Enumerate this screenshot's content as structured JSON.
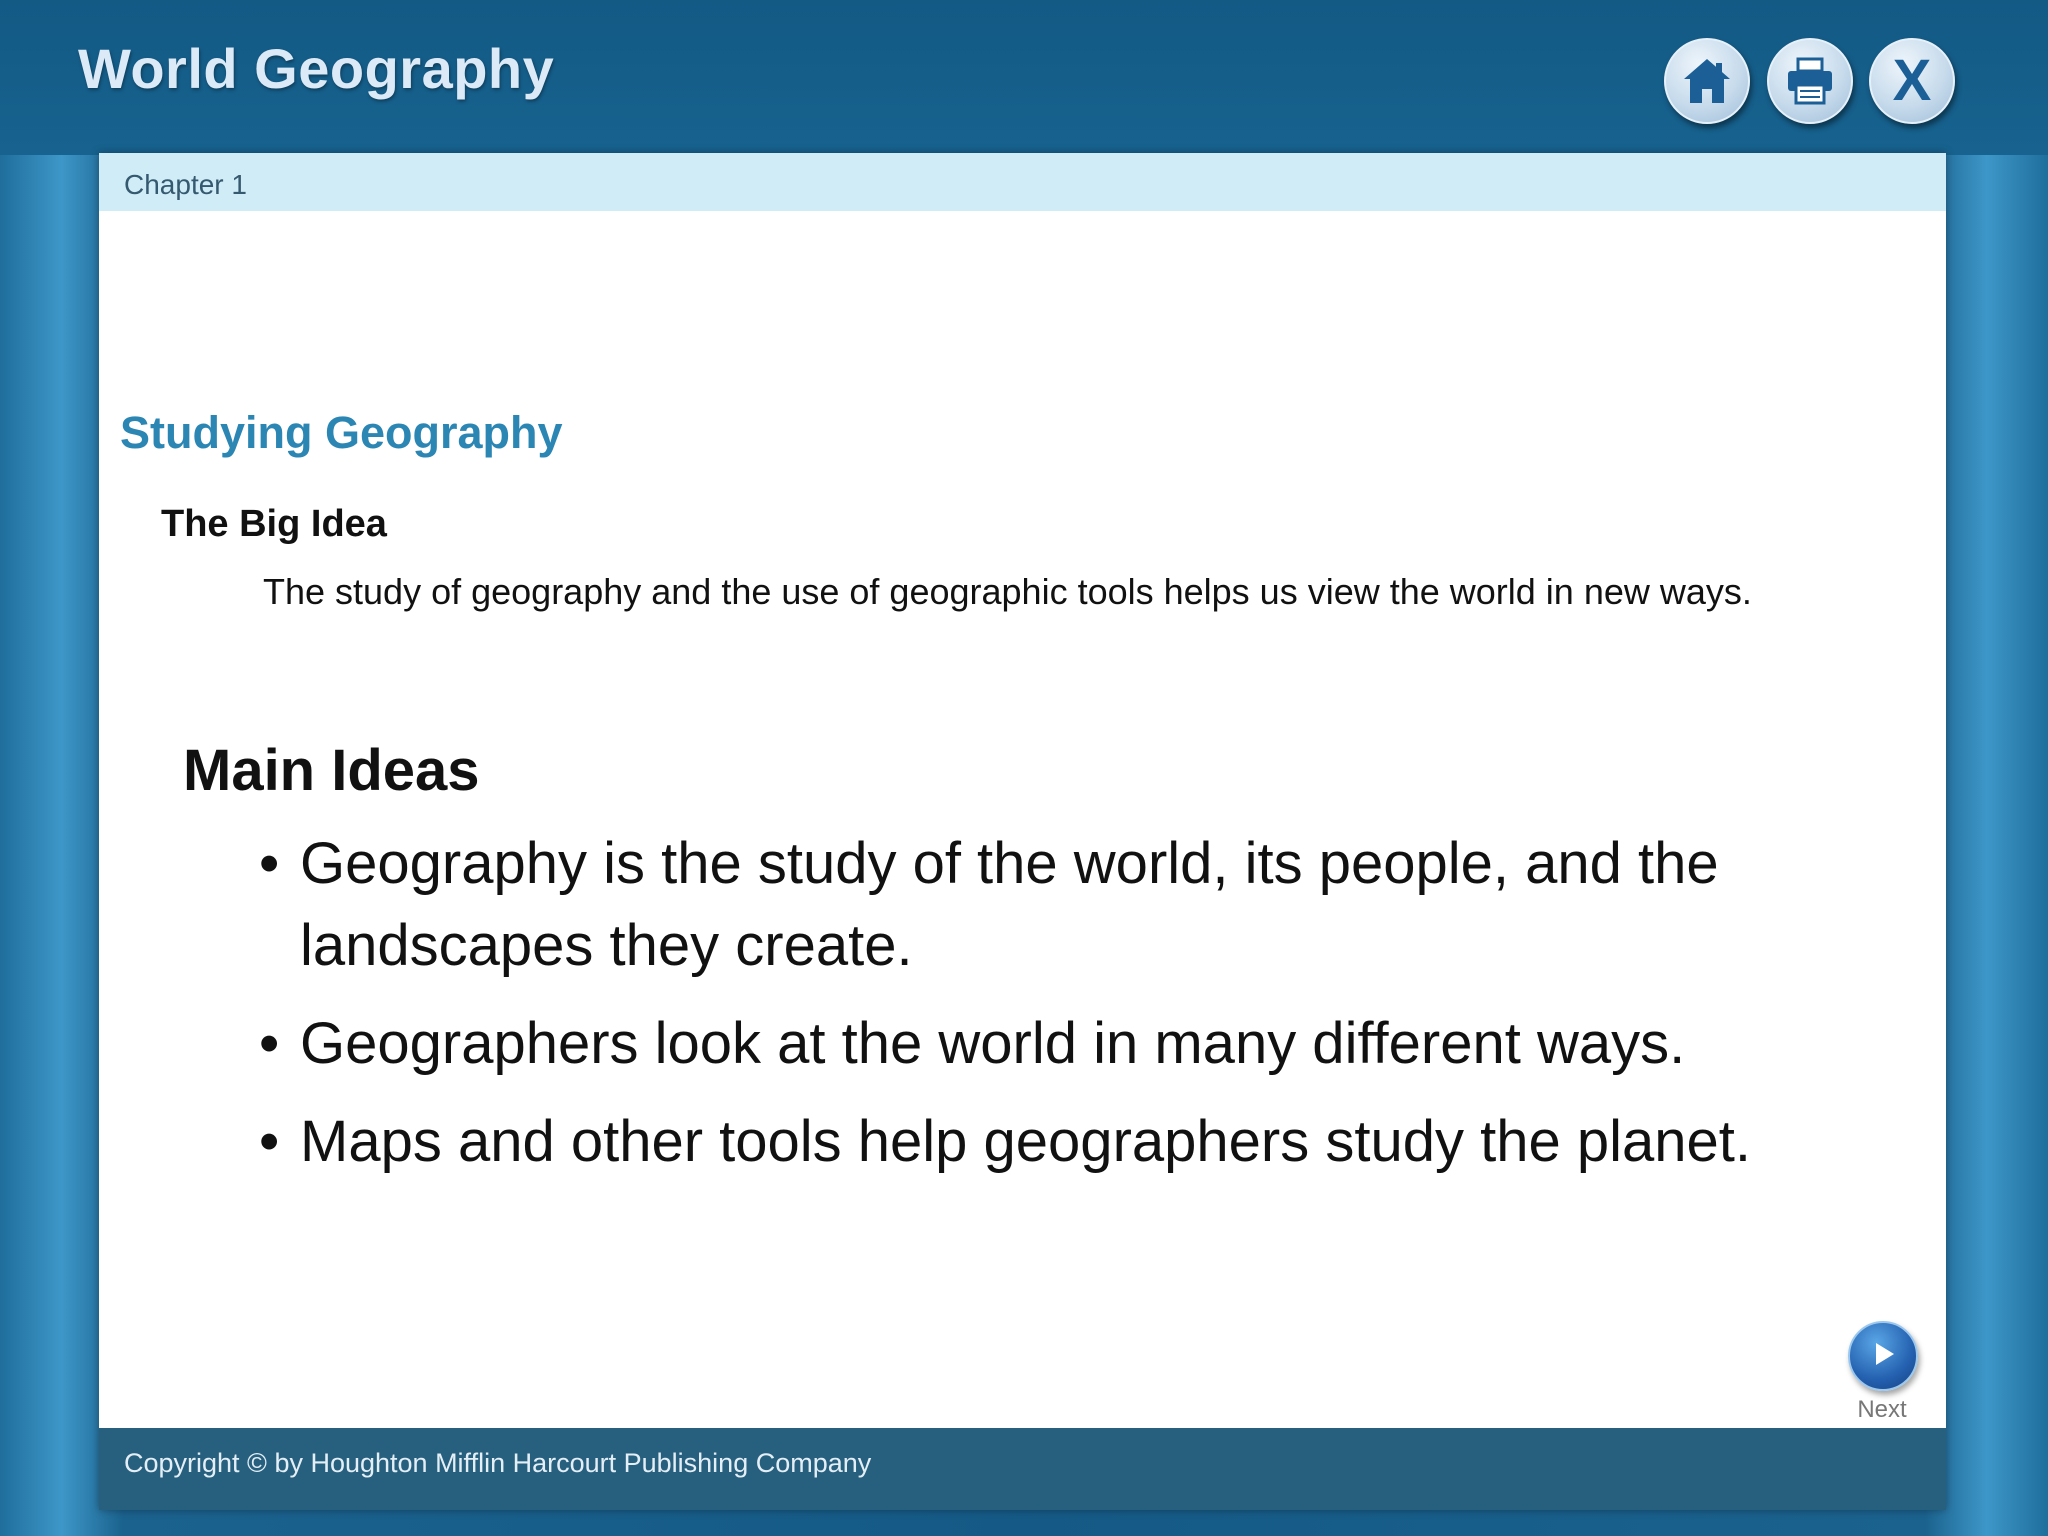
{
  "header": {
    "title": "World Geography",
    "buttons": {
      "home_icon": "home-icon",
      "print_icon": "printer-icon",
      "close_icon": "close-icon",
      "close_glyph": "X"
    }
  },
  "chapter": {
    "label": "Chapter 1"
  },
  "section": {
    "title": "Studying Geography",
    "big_idea_title": "The Big Idea",
    "big_idea_text": "The study of geography and the use of geographic tools helps us view the world in new ways."
  },
  "main_ideas": {
    "title": "Main Ideas",
    "items": [
      "Geography is the study of the world, its people, and the landscapes they create.",
      "Geographers look at the world in many different ways.",
      "Maps and other tools help geographers study the planet."
    ]
  },
  "navigation": {
    "next_label": "Next",
    "next_icon": "play-arrow-icon"
  },
  "footer": {
    "copyright": "Copyright © by Houghton Mifflin Harcourt Publishing Company"
  },
  "colors": {
    "frame_blue": "#155a86",
    "chapter_bar": "#d0ecf7",
    "section_title": "#2b86b4",
    "footer_bar": "#27607f"
  }
}
